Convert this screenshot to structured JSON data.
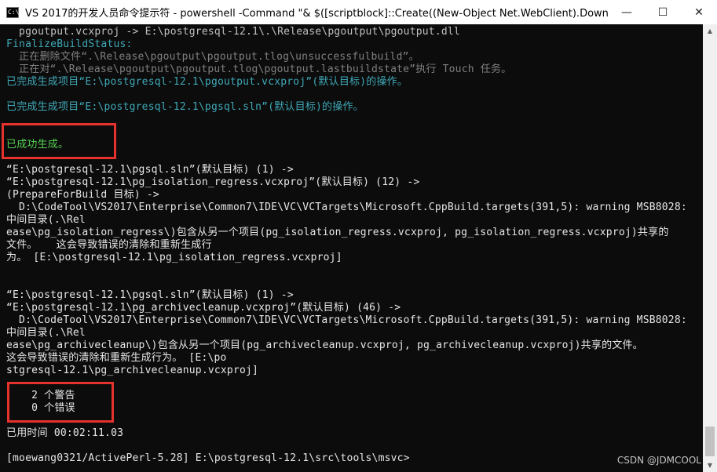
{
  "window": {
    "title": "VS 2017的开发人员命令提示符 - powershell  -Command \"& $([scriptblock]::Create((New-Object Net.WebClient).DownloadStri...",
    "icon": "terminal-icon",
    "minimize_symbol": "—",
    "maximize_symbol": "☐",
    "close_symbol": "✕"
  },
  "console": {
    "lines": [
      {
        "text": "  pgoutput.vcxproj -> E:\\postgresql-12.1\\.\\Release\\pgoutput\\pgoutput.dll",
        "color": "#c0c0c0"
      },
      {
        "text": "FinalizeBuildStatus:",
        "color": "#3fa8b7"
      },
      {
        "text": "  正在删除文件“.\\Release\\pgoutput\\pgoutput.tlog\\unsuccessfulbuild”。",
        "color": "#808080"
      },
      {
        "text": "  正在对“.\\Release\\pgoutput\\pgoutput.tlog\\pgoutput.lastbuildstate”执行 Touch 任务。",
        "color": "#808080"
      },
      {
        "text": "已完成生成项目“E:\\postgresql-12.1\\pgoutput.vcxproj”(默认目标)的操作。",
        "color": "#3fa8b7"
      },
      {
        "text": "",
        "color": "#c0c0c0"
      },
      {
        "text": "已完成生成项目“E:\\postgresql-12.1\\pgsql.sln”(默认目标)的操作。",
        "color": "#3fa8b7"
      },
      {
        "text": "",
        "color": "#c0c0c0"
      },
      {
        "text": "",
        "color": "#c0c0c0"
      },
      {
        "text": "已成功生成。",
        "color": "#55d050"
      },
      {
        "text": "",
        "color": "#c0c0c0"
      },
      {
        "text": "“E:\\postgresql-12.1\\pgsql.sln”(默认目标) (1) ->",
        "color": "#e6e6e6"
      },
      {
        "text": "“E:\\postgresql-12.1\\pg_isolation_regress.vcxproj”(默认目标) (12) ->",
        "color": "#e6e6e6"
      },
      {
        "text": "(PrepareForBuild 目标) ->",
        "color": "#e6e6e6"
      },
      {
        "text": "  D:\\CodeTool\\VS2017\\Enterprise\\Common7\\IDE\\VC\\VCTargets\\Microsoft.CppBuild.targets(391,5): warning MSB8028:",
        "color": "#e6e6e6"
      },
      {
        "text": "中间目录(.\\Rel",
        "color": "#e6e6e6"
      },
      {
        "text": "ease\\pg_isolation_regress\\)包含从另一个项目(pg_isolation_regress.vcxproj, pg_isolation_regress.vcxproj)共享的",
        "color": "#e6e6e6"
      },
      {
        "text": "文件。   这会导致错误的清除和重新生成行",
        "color": "#e6e6e6"
      },
      {
        "text": "为。 [E:\\postgresql-12.1\\pg_isolation_regress.vcxproj]",
        "color": "#e6e6e6"
      },
      {
        "text": "",
        "color": "#c0c0c0"
      },
      {
        "text": "",
        "color": "#c0c0c0"
      },
      {
        "text": "“E:\\postgresql-12.1\\pgsql.sln”(默认目标) (1) ->",
        "color": "#e6e6e6"
      },
      {
        "text": "“E:\\postgresql-12.1\\pg_archivecleanup.vcxproj”(默认目标) (46) ->",
        "color": "#e6e6e6"
      },
      {
        "text": "  D:\\CodeTool\\VS2017\\Enterprise\\Common7\\IDE\\VC\\VCTargets\\Microsoft.CppBuild.targets(391,5): warning MSB8028:",
        "color": "#e6e6e6"
      },
      {
        "text": "中间目录(.\\Rel",
        "color": "#e6e6e6"
      },
      {
        "text": "ease\\pg_archivecleanup\\)包含从另一个项目(pg_archivecleanup.vcxproj, pg_archivecleanup.vcxproj)共享的文件。",
        "color": "#e6e6e6"
      },
      {
        "text": "这会导致错误的清除和重新生成行为。 [E:\\po",
        "color": "#e6e6e6"
      },
      {
        "text": "stgresql-12.1\\pg_archivecleanup.vcxproj]",
        "color": "#e6e6e6"
      },
      {
        "text": "",
        "color": "#c0c0c0"
      },
      {
        "text": "    2 个警告",
        "color": "#e6e6e6"
      },
      {
        "text": "    0 个错误",
        "color": "#e6e6e6"
      },
      {
        "text": "",
        "color": "#c0c0c0"
      },
      {
        "text": "已用时间 00:02:11.03",
        "color": "#e6e6e6"
      },
      {
        "text": "",
        "color": "#c0c0c0"
      },
      {
        "text": "[moewang0321/ActivePerl-5.28] E:\\postgresql-12.1\\src\\tools\\msvc>",
        "color": "#e6e6e6"
      }
    ]
  },
  "watermark": "CSDN @JDMCOOL",
  "colors": {
    "highlight_border": "#e5322d",
    "background": "#0c0c0c"
  }
}
